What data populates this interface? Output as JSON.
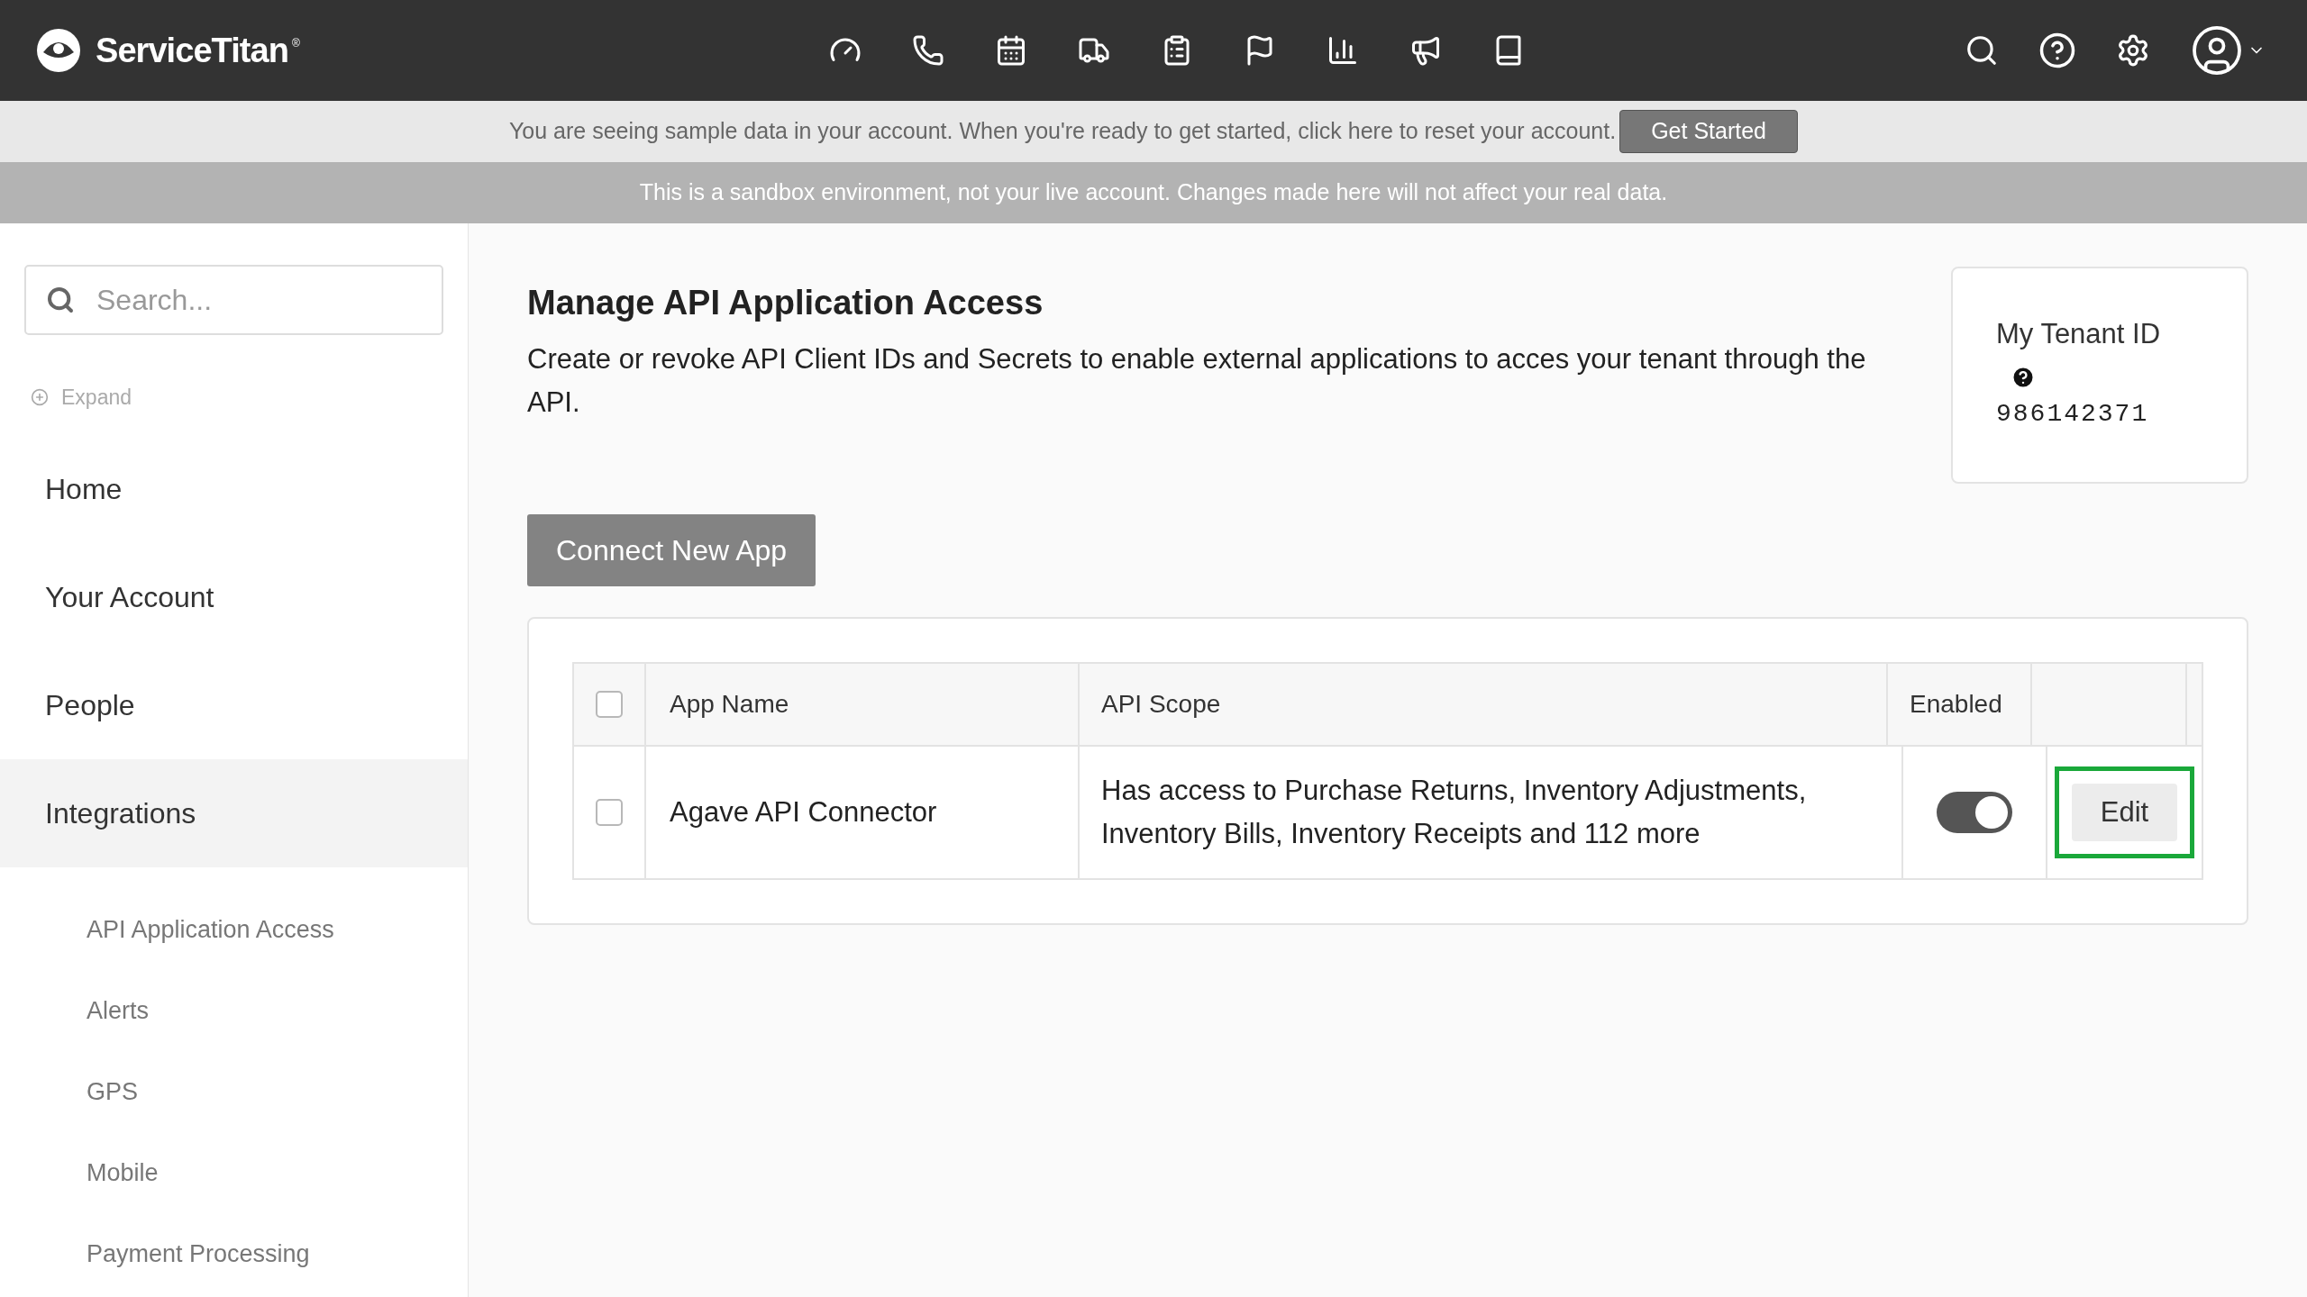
{
  "header": {
    "logo": "ServiceTitan",
    "logo_mark": "®"
  },
  "banners": {
    "sample": "You are seeing sample data in your account. When you're ready to get started, click here to reset your account.",
    "get_started": "Get Started",
    "sandbox": "This is a sandbox environment, not your live account. Changes made here will not affect your real data."
  },
  "sidebar": {
    "search": {
      "placeholder": "Search..."
    },
    "expand": "Expand",
    "items": [
      {
        "label": "Home",
        "selected": false
      },
      {
        "label": "Your Account",
        "selected": false
      },
      {
        "label": "People",
        "selected": false
      },
      {
        "label": "Integrations",
        "selected": true,
        "children": [
          {
            "label": "API Application Access"
          },
          {
            "label": "Alerts"
          },
          {
            "label": "GPS"
          },
          {
            "label": "Mobile"
          },
          {
            "label": "Payment Processing"
          }
        ]
      }
    ]
  },
  "page": {
    "title": "Manage API Application Access",
    "description": "Create or revoke API Client IDs and Secrets to enable external applications to acces your tenant through the API.",
    "connect_button": "Connect New App"
  },
  "tenant": {
    "label": "My Tenant ID",
    "id": "986142371"
  },
  "table": {
    "columns": [
      "App Name",
      "API Scope",
      "Enabled"
    ],
    "header_checked": false,
    "rows": [
      {
        "checked": false,
        "app_name": "Agave API Connector",
        "api_scope": "Has access to Purchase Returns, Inventory Adjustments, Inventory Bills, Inventory Receipts and 112 more",
        "enabled": true,
        "action": "Edit",
        "highlighted": true
      }
    ]
  }
}
